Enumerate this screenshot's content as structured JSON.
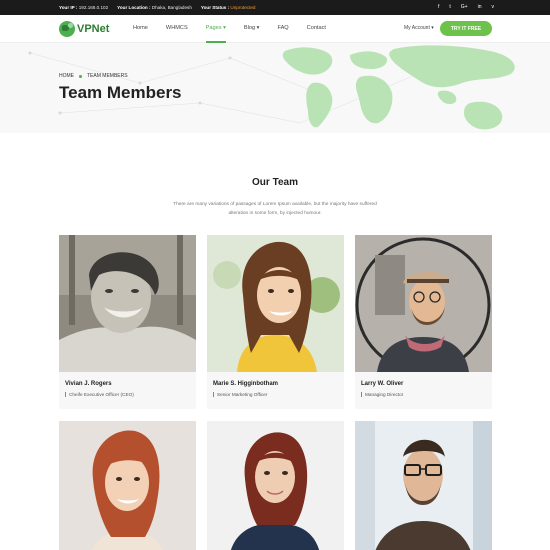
{
  "topbar": {
    "ip_label": "Your IP :",
    "ip_value": "192.168.0.102",
    "location_label": "Your Location :",
    "location_value": "Dhaka, Bangladesh",
    "status_label": "Your Status :",
    "status_value": "Unprotected",
    "social": [
      "f",
      "t",
      "G+",
      "in",
      "v"
    ]
  },
  "nav": {
    "logo": "VPNet",
    "items": [
      {
        "label": "Home"
      },
      {
        "label": "WHMCS"
      },
      {
        "label": "Pages ▾"
      },
      {
        "label": "Blog ▾"
      },
      {
        "label": "FAQ"
      },
      {
        "label": "Contact"
      }
    ],
    "active_index": 2,
    "account": "My Account ▾",
    "cta": "TRY IT FREE"
  },
  "hero": {
    "breadcrumb_home": "HOME",
    "breadcrumb_current": "TEAM MEMBERS",
    "title": "Team Members"
  },
  "section": {
    "title": "Our Team",
    "description": "There are many variations of passages of Lorem Ipsum available, but the majority have suffered alteration in some form, by injected humour."
  },
  "team": [
    {
      "name": "Vivian J. Rogers",
      "role": "Cheife Executive Officer (CEO)"
    },
    {
      "name": "Marie S. Higginbotham",
      "role": "Senior Marketing Officer"
    },
    {
      "name": "Larry W. Oliver",
      "role": "Managing Director"
    },
    {
      "name": "",
      "role": ""
    },
    {
      "name": "",
      "role": ""
    },
    {
      "name": "",
      "role": ""
    }
  ],
  "colors": {
    "brand_green": "#4caf50",
    "cta_green": "#6cc24a",
    "status_orange": "#ff9a28",
    "topbar_bg": "#1b1b1b"
  }
}
